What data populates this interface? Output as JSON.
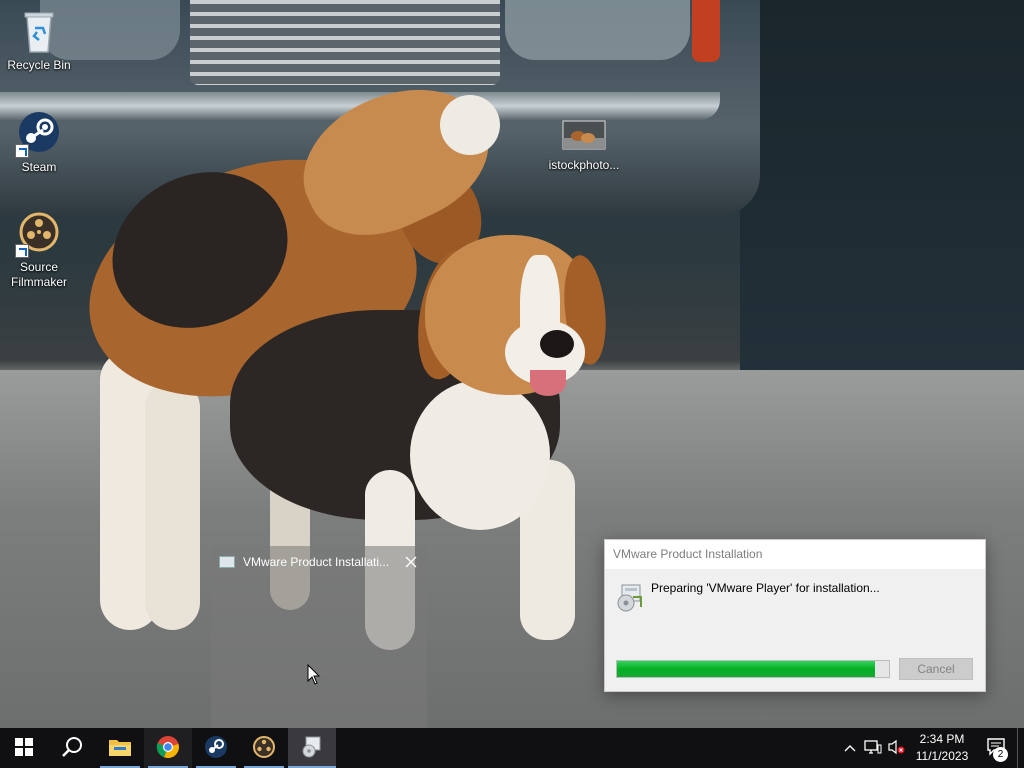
{
  "desktop": {
    "icons": [
      {
        "label": "Recycle Bin",
        "icon": "recycle-bin-icon"
      },
      {
        "label": "Steam",
        "icon": "steam-icon"
      },
      {
        "label": "Source Filmmaker",
        "icon": "source-filmmaker-icon"
      },
      {
        "label": "istockphoto...",
        "icon": "image-file-icon"
      }
    ]
  },
  "ghost_window": {
    "title": "VMware Product Installati...",
    "close_icon": "close-icon"
  },
  "dialog": {
    "title": "VMware Product Installation",
    "message": "Preparing 'VMware Player' for installation...",
    "progress": 0.95,
    "cancel_label": "Cancel",
    "progress_color": "#06b025"
  },
  "taskbar": {
    "items": [
      {
        "name": "start-button",
        "icon": "windows-logo-icon"
      },
      {
        "name": "search-button",
        "icon": "search-icon"
      },
      {
        "name": "file-explorer",
        "icon": "folder-icon"
      },
      {
        "name": "chrome",
        "icon": "chrome-icon"
      },
      {
        "name": "steam",
        "icon": "steam-icon"
      },
      {
        "name": "source-filmmaker",
        "icon": "source-filmmaker-icon"
      },
      {
        "name": "vmware-installer",
        "icon": "installer-icon"
      }
    ],
    "tray": {
      "time": "2:34 PM",
      "date": "11/1/2023",
      "notification_count": "2"
    }
  }
}
